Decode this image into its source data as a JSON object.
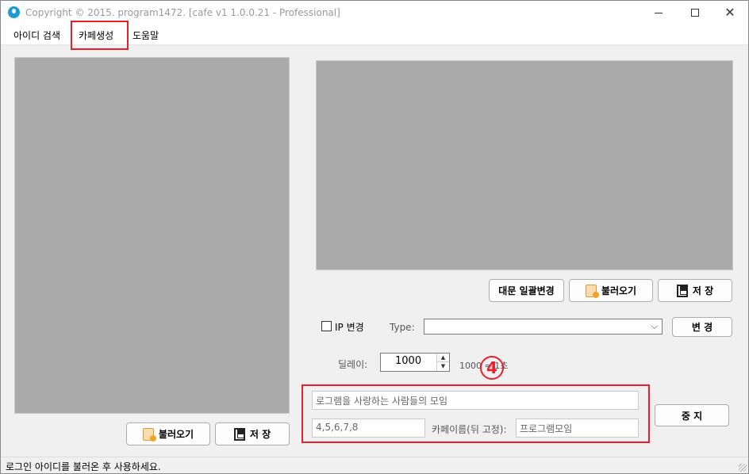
{
  "window": {
    "title": "Copyright © 2015. program1472. [cafe v1 1.0.0.21 - Professional]",
    "controls": {
      "minimize": "",
      "maximize": "",
      "close": "✕"
    }
  },
  "menu": {
    "items": [
      "아이디 검색",
      "카페생성",
      "도움말"
    ]
  },
  "left_panel": {
    "load_label": "불러오기",
    "save_label": "저  장"
  },
  "right_panel": {
    "bulk_change_label": "대문 일괄변경",
    "load_label": "불러오기",
    "save_label": "저  장"
  },
  "ip": {
    "checkbox_label": "IP 변경",
    "type_label": "Type:",
    "type_value": "",
    "change_label": "변  경"
  },
  "delay": {
    "label": "딜레이:",
    "value": "1000",
    "note": "1000 = 1초"
  },
  "annotation": {
    "badge": "4"
  },
  "cafe": {
    "title_placeholder": "로그램을 사랑하는 사람들의 모임",
    "numbers_value": "4,5,6,7,8",
    "name_label": "카페이름(뒤 고정):",
    "name_value": "프로그램모임",
    "stop_label": "중  지"
  },
  "status": {
    "text": "로그인 아이디를 불러온 후 사용하세요."
  },
  "colors": {
    "highlight": "#e8202a",
    "panel": "#aaaaaa"
  }
}
